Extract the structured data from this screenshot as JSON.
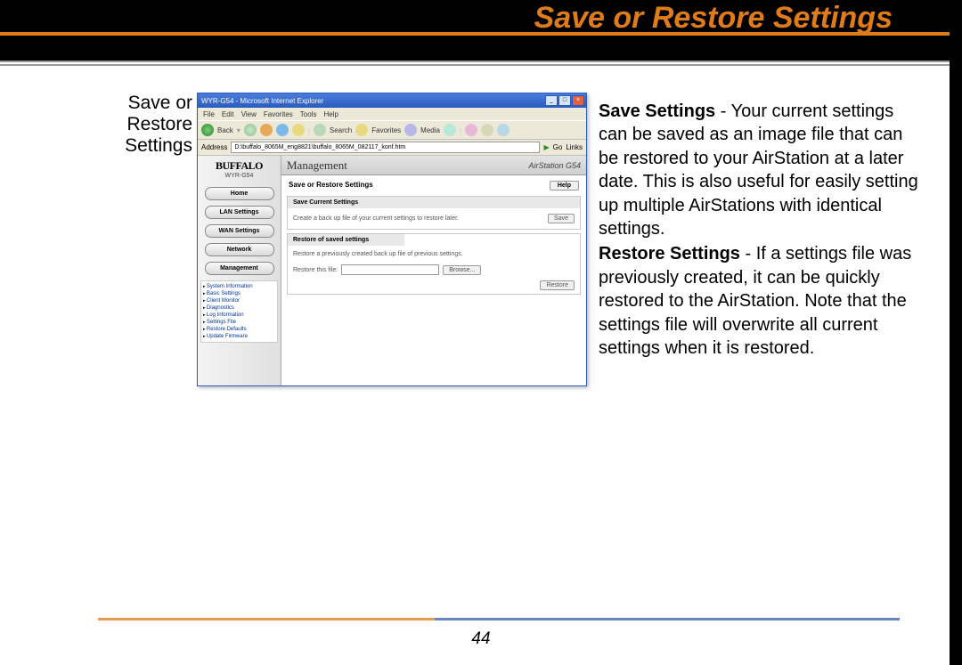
{
  "header": {
    "title": "Save or Restore Settings"
  },
  "left_label": {
    "line1": "Save or",
    "line2": "Restore",
    "line3": "Settings"
  },
  "ie": {
    "title": "WYR-G54 - Microsoft Internet Explorer",
    "menu": [
      "File",
      "Edit",
      "View",
      "Favorites",
      "Tools",
      "Help"
    ],
    "toolbar": {
      "back": "Back",
      "search": "Search",
      "favorites": "Favorites",
      "media": "Media"
    },
    "address_label": "Address",
    "address": "D:\\buffalo_8065M_eng8821\\buffalo_8065M_082117_konf.htm",
    "go": "Go",
    "links": "Links"
  },
  "sidebar": {
    "brand": "BUFFALO",
    "model": "WYR-G54",
    "buttons": [
      "Home",
      "LAN Settings",
      "WAN Settings",
      "Network",
      "Management"
    ],
    "sublinks": [
      "System Information",
      "Basic Settings",
      "Client Monitor",
      "Diagnostics",
      "Log Information",
      "Settings File",
      "Restore Defaults",
      "Update Firmware"
    ]
  },
  "main": {
    "mgmt": "Management",
    "airstation": "AirStation G54",
    "page_title": "Save or Restore Settings",
    "help": "Help",
    "save_panel": {
      "title": "Save Current Settings",
      "text": "Create a back up file of your current settings to restore later.",
      "button": "Save"
    },
    "restore_panel": {
      "title": "Restore of saved settings",
      "text": "Restore a previously created back up file of previous settings.",
      "file_label": "Restore this file:",
      "browse": "Browse...",
      "restore": "Restore"
    }
  },
  "description": {
    "save_bold": "Save Settings",
    "save_text": " - Your current settings can be saved as an image file that can be restored to your AirStation at a later date. This is also useful for easily setting up multiple AirStations with identical settings.",
    "restore_bold": "Restore Settings",
    "restore_text": " - If a settings file was previously created, it can be quickly restored to the AirStation. Note that the settings file will overwrite all current settings when it is restored."
  },
  "page_number": "44"
}
